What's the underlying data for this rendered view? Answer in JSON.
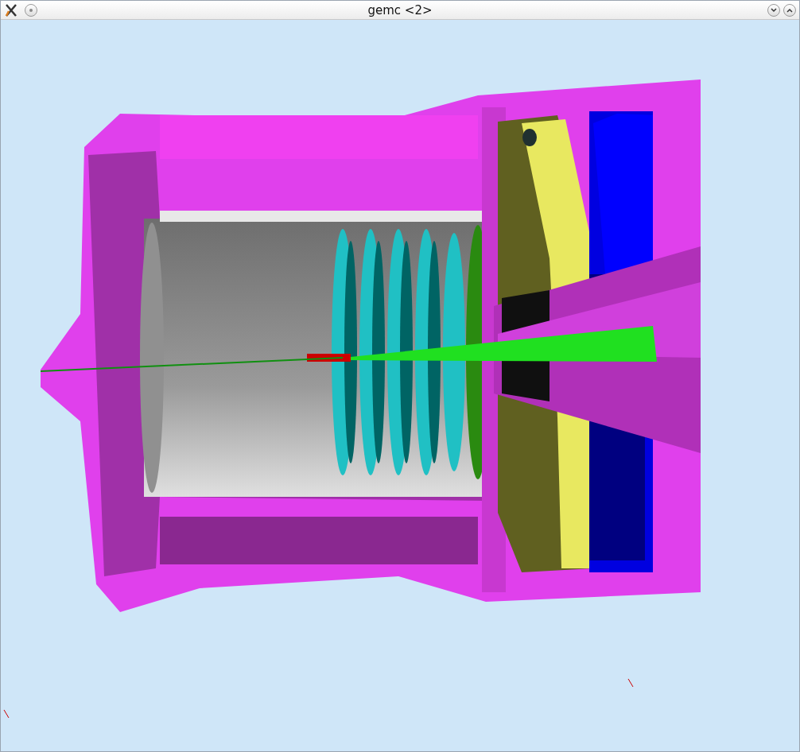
{
  "window": {
    "title": "gemc <2>"
  }
}
